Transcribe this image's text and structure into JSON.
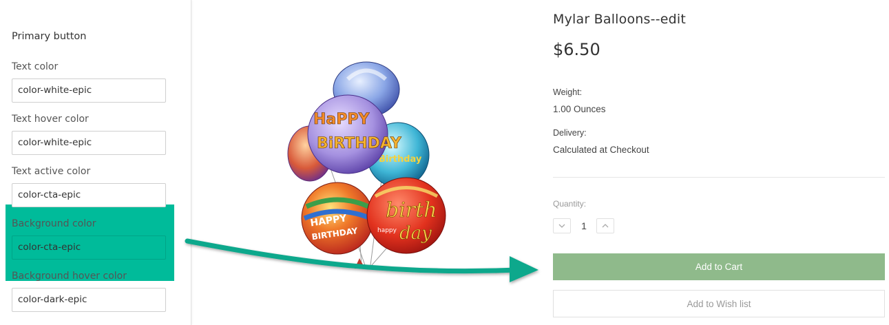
{
  "settings": {
    "section_title": "Primary button",
    "fields": [
      {
        "label": "Text color",
        "value": "color-white-epic"
      },
      {
        "label": "Text hover color",
        "value": "color-white-epic"
      },
      {
        "label": "Text active color",
        "value": "color-cta-epic"
      },
      {
        "label": "Background color",
        "value": "color-cta-epic"
      },
      {
        "label": "Background hover color",
        "value": "color-dark-epic"
      }
    ],
    "highlight_color": "#00bb9a"
  },
  "product": {
    "title": "Mylar Balloons--edit",
    "price": "$6.50",
    "weight_label": "Weight:",
    "weight_value": "1.00 Ounces",
    "delivery_label": "Delivery:",
    "delivery_value": "Calculated at Checkout",
    "quantity_label": "Quantity:",
    "quantity_value": "1",
    "add_to_cart_label": "Add to Cart",
    "wishlist_label": "Add to Wish list",
    "cta_color": "#8fba8b"
  },
  "icons": {
    "decrement": "chevron-down-icon",
    "increment": "chevron-up-icon",
    "arrow": "arrow-right-icon"
  }
}
